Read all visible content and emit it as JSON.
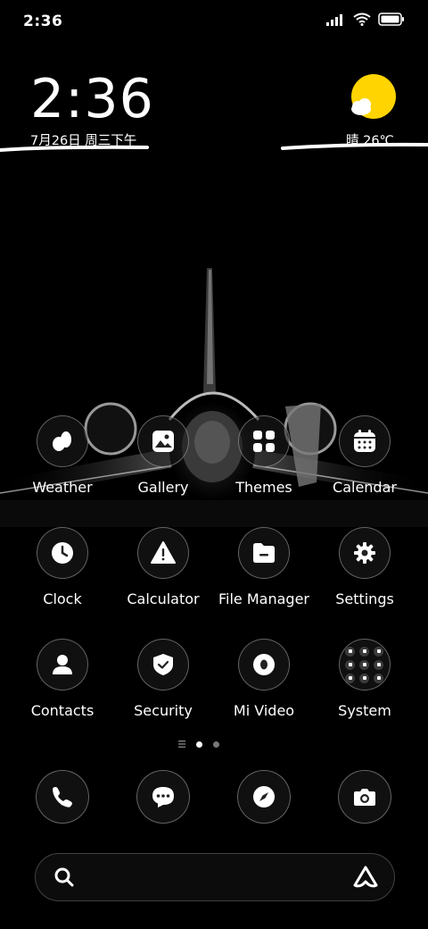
{
  "status_bar": {
    "time": "2:36",
    "icons": [
      "signal-icon",
      "wifi-icon",
      "battery-icon"
    ]
  },
  "clock_widget": {
    "time": "2:36",
    "date": "7月26日 周三下午"
  },
  "weather_widget": {
    "condition_icon": "partly-sunny-icon",
    "text": "晴 26℃"
  },
  "apps": [
    {
      "label": "Weather",
      "icon": "weather-icon"
    },
    {
      "label": "Gallery",
      "icon": "gallery-icon"
    },
    {
      "label": "Themes",
      "icon": "themes-icon"
    },
    {
      "label": "Calendar",
      "icon": "calendar-icon"
    },
    {
      "label": "Clock",
      "icon": "clock-icon"
    },
    {
      "label": "Calculator",
      "icon": "calculator-icon"
    },
    {
      "label": "File Manager",
      "icon": "file-manager-icon"
    },
    {
      "label": "Settings",
      "icon": "settings-icon"
    },
    {
      "label": "Contacts",
      "icon": "contacts-icon"
    },
    {
      "label": "Security",
      "icon": "security-icon"
    },
    {
      "label": "Mi Video",
      "icon": "mi-video-icon"
    },
    {
      "label": "System",
      "icon": "system-folder-icon"
    }
  ],
  "dock": [
    {
      "icon": "phone-icon"
    },
    {
      "icon": "messages-icon"
    },
    {
      "icon": "browser-icon"
    },
    {
      "icon": "camera-icon"
    }
  ],
  "page_indicator": {
    "pages": 2,
    "current": 1
  },
  "search": {
    "placeholder": "",
    "value": ""
  },
  "colors": {
    "sun": "#FFD400",
    "background": "#000000"
  }
}
